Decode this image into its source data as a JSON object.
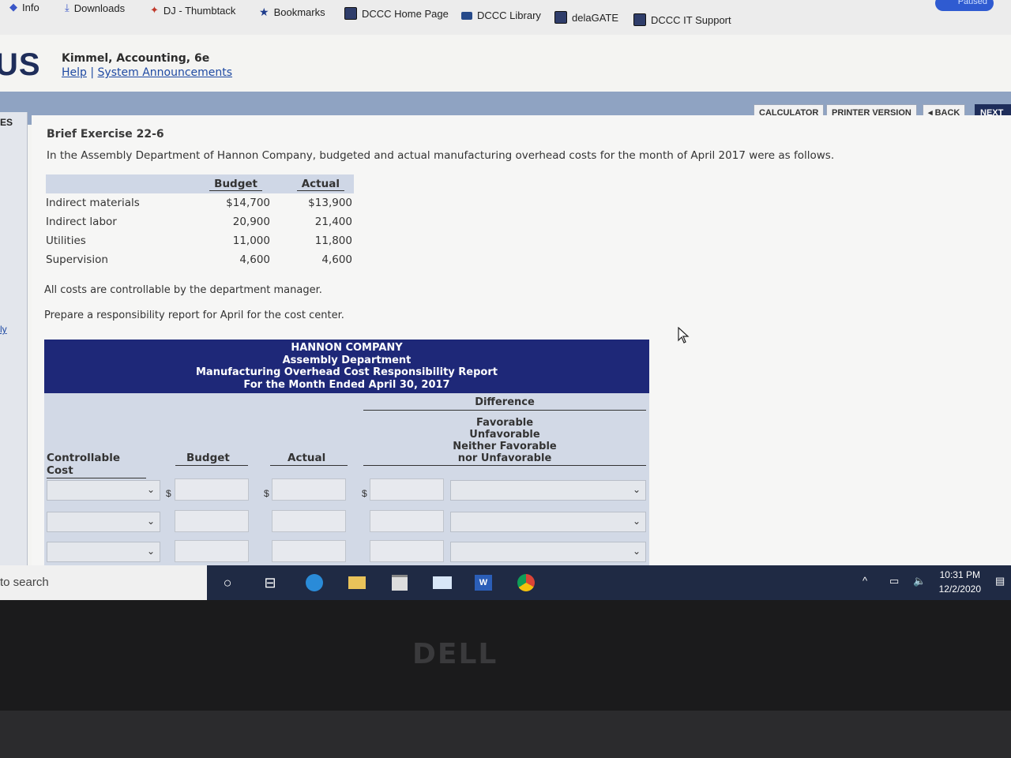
{
  "bookmarks": [
    {
      "label": "Info",
      "icon": "shield-icon"
    },
    {
      "label": "Downloads",
      "icon": "download-icon"
    },
    {
      "label": "DJ - Thumbtack",
      "icon": "pin-icon"
    },
    {
      "label": "Bookmarks",
      "icon": "star-icon"
    },
    {
      "label": "DCCC Home Page",
      "icon": "dccc-icon"
    },
    {
      "label": "DCCC Library",
      "icon": "cloud-icon"
    },
    {
      "label": "delaGATE",
      "icon": "dccc-icon"
    },
    {
      "label": "DCCC IT Support",
      "icon": "dccc-icon"
    }
  ],
  "browser": {
    "paused_label": "Paused"
  },
  "header": {
    "logo": "US",
    "book_title": "Kimmel, Accounting, 6e",
    "help_link": "Help",
    "separator": "|",
    "announcements_link": "System Announcements"
  },
  "toolbar": {
    "calculator": "CALCULATOR",
    "printer": "PRINTER VERSION",
    "back": "◂ BACK",
    "next": "NEXT ▸"
  },
  "leftnav": {
    "top_label": "ES",
    "link_label": "ly"
  },
  "exercise": {
    "title": "Brief Exercise 22-6",
    "intro": "In the Assembly Department of Hannon Company, budgeted and actual manufacturing overhead costs for the month of April 2017 were as follows.",
    "table_headers": {
      "budget": "Budget",
      "actual": "Actual"
    },
    "rows": [
      {
        "label": "Indirect materials",
        "budget": "$14,700",
        "actual": "$13,900"
      },
      {
        "label": "Indirect labor",
        "budget": "20,900",
        "actual": "21,400"
      },
      {
        "label": "Utilities",
        "budget": "11,000",
        "actual": "11,800"
      },
      {
        "label": "Supervision",
        "budget": "4,600",
        "actual": "4,600"
      }
    ],
    "note": "All costs are controllable by the department manager.",
    "instruction": "Prepare a responsibility report for April for the cost center."
  },
  "report": {
    "company": "HANNON COMPANY",
    "department": "Assembly Department",
    "report_name": "Manufacturing Overhead Cost Responsibility Report",
    "period": "For the Month Ended April 30, 2017",
    "col_controllable": "Controllable Cost",
    "col_budget": "Budget",
    "col_actual": "Actual",
    "col_difference": "Difference",
    "fav_line1": "Favorable",
    "fav_line2": "Unfavorable",
    "fav_line3": "Neither Favorable",
    "fav_line4": "nor Unfavorable",
    "currency_symbol": "$"
  },
  "taskbar": {
    "search_text": "to search",
    "time": "10:31 PM",
    "date": "12/2/2020"
  },
  "monitor": {
    "brand": "DELL"
  }
}
